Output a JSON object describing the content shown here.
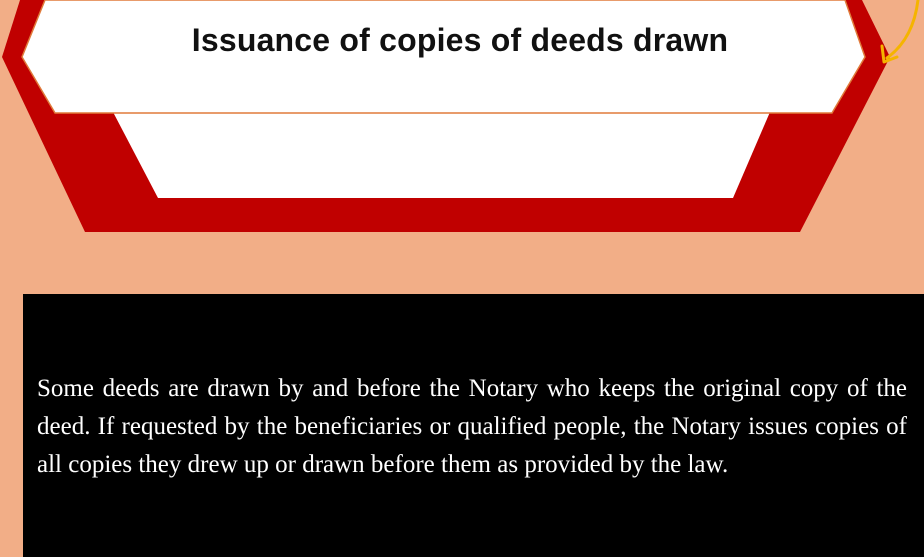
{
  "title": "Issuance of copies of deeds drawn",
  "body": "Some deeds are drawn by and before the Notary who keeps the original copy of the deed. If requested by the beneficiaries or qualified people, the Notary issues copies of all copies they drew up or drawn before them as provided by the law.",
  "colors": {
    "background": "#F2AE87",
    "banner_red": "#C00000",
    "banner_fill": "#FFFFFF",
    "banner_outline": "#E07A3A",
    "arrow_yellow": "#F5B400",
    "textbox": "#000000",
    "body_text": "#FFFFFF"
  },
  "icons": [
    "curved-arrow-icon"
  ]
}
